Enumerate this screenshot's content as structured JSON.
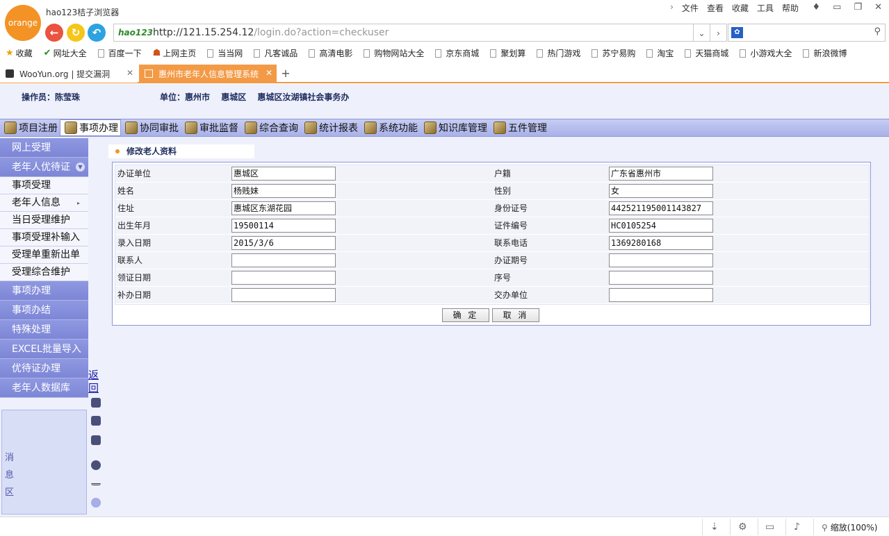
{
  "browser": {
    "logo": "orange",
    "title": "hao123桔子浏览器",
    "menus": [
      "文件",
      "查看",
      "收藏",
      "工具",
      "帮助"
    ],
    "url_host": "http://121.15.254.12",
    "url_path": "/login.do?action=checkuser",
    "hao_label": "hao123",
    "favorites": [
      "收藏",
      "网址大全",
      "百度一下",
      "上网主页",
      "当当网",
      "凡客诚品",
      "高清电影",
      "购物网站大全",
      "京东商城",
      "聚划算",
      "热门游戏",
      "苏宁易购",
      "淘宝",
      "天猫商城",
      "小游戏大全",
      "新浪微博"
    ],
    "tabs": [
      {
        "label": "WooYun.org | 提交漏洞",
        "active": false
      },
      {
        "label": "惠州市老年人信息管理系统",
        "active": true
      }
    ],
    "zoom": "缩放(100%)",
    "accent_color": "#f39325"
  },
  "header": {
    "operator_label": "操作员：陈莹珠",
    "unit_label": "单位：惠州市",
    "unit_district": "惠城区",
    "unit_office": "惠城区汝湖镇社会事务办"
  },
  "topmenu": [
    "项目注册",
    "事项办理",
    "协同审批",
    "审批监督",
    "综合查询",
    "统计报表",
    "系统功能",
    "知识库管理",
    "五件管理"
  ],
  "sidebar": {
    "items": [
      {
        "label": "网上受理",
        "type": "section"
      },
      {
        "label": "老年人优待证",
        "type": "section"
      },
      {
        "label": "事项受理",
        "type": "sub"
      },
      {
        "label": "老年人信息",
        "type": "sub"
      },
      {
        "label": "当日受理维护",
        "type": "sub"
      },
      {
        "label": "事项受理补输入",
        "type": "sub"
      },
      {
        "label": "受理单重新出单",
        "type": "sub"
      },
      {
        "label": "受理综合维护",
        "type": "sub"
      },
      {
        "label": "事项办理",
        "type": "section"
      },
      {
        "label": "事项办结",
        "type": "section"
      },
      {
        "label": "特殊处理",
        "type": "section"
      },
      {
        "label": "EXCEL批量导入",
        "type": "section"
      },
      {
        "label": "优待证办理",
        "type": "section"
      },
      {
        "label": "老年人数据库",
        "type": "section"
      }
    ],
    "back_label": "返回",
    "message_label": "消息区"
  },
  "form": {
    "title": "修改老人资料",
    "rows": [
      {
        "l1": "办证单位",
        "v1": "惠城区",
        "l2": "户籍",
        "v2": "广东省惠州市"
      },
      {
        "l1": "姓名",
        "v1": "杨贱妹",
        "l2": "性别",
        "v2": "女"
      },
      {
        "l1": "住址",
        "v1": "惠城区东湖花园",
        "l2": "身份证号",
        "v2": "442521195001143827"
      },
      {
        "l1": "出生年月",
        "v1": "19500114",
        "l2": "证件编号",
        "v2": "HC0105254"
      },
      {
        "l1": "录入日期",
        "v1": "2015/3/6",
        "l2": "联系电话",
        "v2": "1369280168"
      },
      {
        "l1": "联系人",
        "v1": "",
        "l2": "办证期号",
        "v2": ""
      },
      {
        "l1": "领证日期",
        "v1": "",
        "l2": "序号",
        "v2": ""
      },
      {
        "l1": "补办日期",
        "v1": "",
        "l2": "交办单位",
        "v2": ""
      }
    ],
    "confirm": "确 定",
    "cancel": "取 消"
  }
}
